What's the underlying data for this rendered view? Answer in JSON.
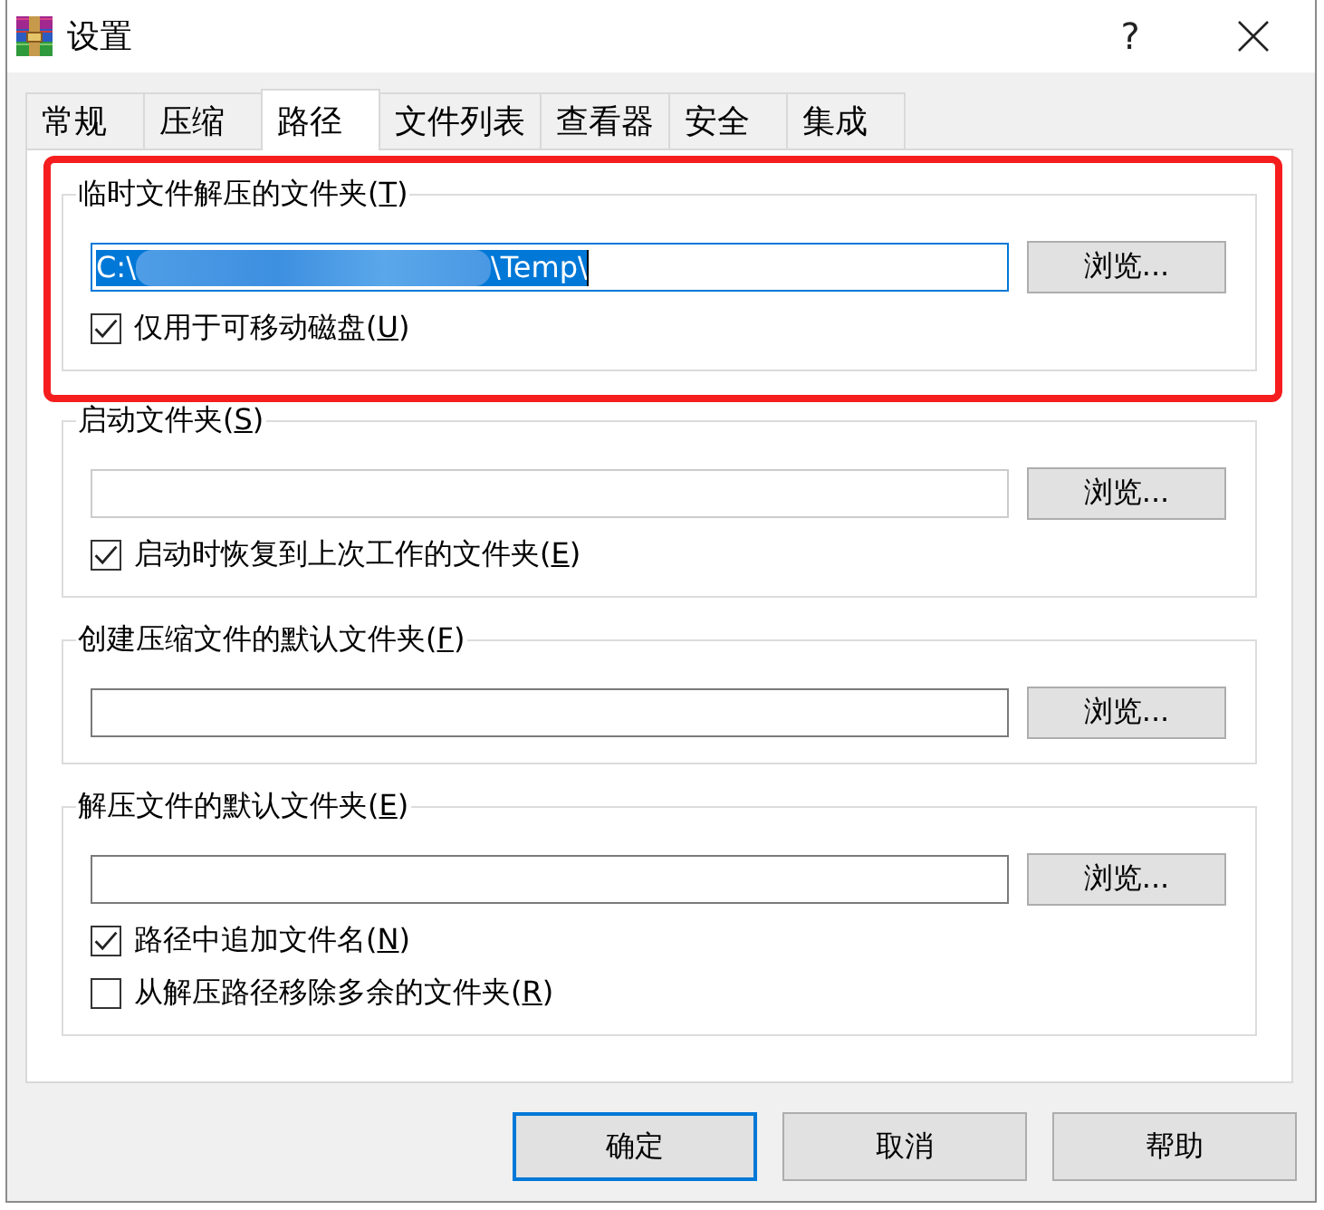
{
  "window": {
    "title": "设置",
    "help_button": "?"
  },
  "tabs": [
    {
      "label": "常规",
      "selected": false
    },
    {
      "label": "压缩",
      "selected": false
    },
    {
      "label": "路径",
      "selected": true
    },
    {
      "label": "文件列表",
      "selected": false
    },
    {
      "label": "查看器",
      "selected": false
    },
    {
      "label": "安全",
      "selected": false
    },
    {
      "label": "集成",
      "selected": false
    }
  ],
  "groups": [
    {
      "label": "临时文件解压的文件夹(T)",
      "highlighted": true,
      "field": {
        "value": "C:\\",
        "value_end": "\\Temp\\",
        "redacted": true,
        "focused": true,
        "text_selected": true,
        "disabled": false
      },
      "browse_button": "浏览...",
      "checkboxes": [
        {
          "label": "仅用于可移动磁盘(U)",
          "checked": true
        }
      ]
    },
    {
      "label": "启动文件夹(S)",
      "highlighted": false,
      "field": {
        "focused": false,
        "disabled": true
      },
      "browse_button": "浏览...",
      "checkboxes": [
        {
          "label": "启动时恢复到上次工作的文件夹(E)",
          "checked": true
        }
      ]
    },
    {
      "label": "创建压缩文件的默认文件夹(F)",
      "highlighted": false,
      "field": {
        "focused": false,
        "disabled": false
      },
      "browse_button": "浏览..."
    },
    {
      "label": "解压文件的默认文件夹(E)",
      "highlighted": false,
      "field": {
        "focused": false,
        "disabled": false
      },
      "browse_button": "浏览...",
      "checkboxes": [
        {
          "label": "路径中追加文件名(N)",
          "checked": true
        },
        {
          "label": "从解压路径移除多余的文件夹(R)",
          "checked": false
        }
      ]
    }
  ],
  "buttons": [
    {
      "label": "确定",
      "default": true
    },
    {
      "label": "取消",
      "default": false
    },
    {
      "label": "帮助",
      "default": false
    }
  ]
}
